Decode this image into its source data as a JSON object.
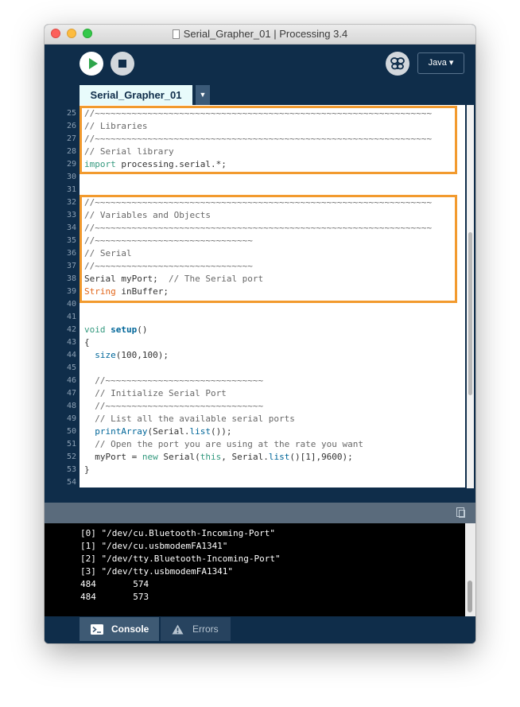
{
  "window": {
    "title": "Serial_Grapher_01 | Processing 3.4"
  },
  "toolbar": {
    "run_icon": "play-icon",
    "stop_icon": "stop-icon",
    "debug_icon": "butterfly-icon",
    "mode_label": "Java ▾"
  },
  "tabs": {
    "active": "Serial_Grapher_01",
    "menu_glyph": "▼"
  },
  "editor": {
    "lines": [
      {
        "n": "25",
        "parts": [
          {
            "t": "//~~~~~~~~~~~~~~~~~~~~~~~~~~~~~~~~~~~~~~~~~~~~~~~~~~~~~~~~~~~~~~~~",
            "c": "comment"
          }
        ]
      },
      {
        "n": "26",
        "parts": [
          {
            "t": "// Libraries",
            "c": "comment"
          }
        ]
      },
      {
        "n": "27",
        "parts": [
          {
            "t": "//~~~~~~~~~~~~~~~~~~~~~~~~~~~~~~~~~~~~~~~~~~~~~~~~~~~~~~~~~~~~~~~~",
            "c": "comment"
          }
        ]
      },
      {
        "n": "28",
        "parts": [
          {
            "t": "// Serial library",
            "c": "comment"
          }
        ]
      },
      {
        "n": "29",
        "parts": [
          {
            "t": "import",
            "c": "kw"
          },
          {
            "t": " processing.serial.*;",
            "c": "plain"
          }
        ]
      },
      {
        "n": "30",
        "parts": []
      },
      {
        "n": "31",
        "parts": []
      },
      {
        "n": "32",
        "parts": [
          {
            "t": "//~~~~~~~~~~~~~~~~~~~~~~~~~~~~~~~~~~~~~~~~~~~~~~~~~~~~~~~~~~~~~~~~",
            "c": "comment"
          }
        ]
      },
      {
        "n": "33",
        "parts": [
          {
            "t": "// Variables and Objects",
            "c": "comment"
          }
        ]
      },
      {
        "n": "34",
        "parts": [
          {
            "t": "//~~~~~~~~~~~~~~~~~~~~~~~~~~~~~~~~~~~~~~~~~~~~~~~~~~~~~~~~~~~~~~~~",
            "c": "comment"
          }
        ]
      },
      {
        "n": "35",
        "parts": [
          {
            "t": "//~~~~~~~~~~~~~~~~~~~~~~~~~~~~~~",
            "c": "comment"
          }
        ]
      },
      {
        "n": "36",
        "parts": [
          {
            "t": "// Serial",
            "c": "comment"
          }
        ]
      },
      {
        "n": "37",
        "parts": [
          {
            "t": "//~~~~~~~~~~~~~~~~~~~~~~~~~~~~~~",
            "c": "comment"
          }
        ]
      },
      {
        "n": "38",
        "parts": [
          {
            "t": "Serial myPort;  ",
            "c": "plain"
          },
          {
            "t": "// The Serial port",
            "c": "comment"
          }
        ]
      },
      {
        "n": "39",
        "parts": [
          {
            "t": "String",
            "c": "type"
          },
          {
            "t": " inBuffer;",
            "c": "plain"
          }
        ]
      },
      {
        "n": "40",
        "parts": []
      },
      {
        "n": "41",
        "parts": []
      },
      {
        "n": "42",
        "parts": [
          {
            "t": "void",
            "c": "kw"
          },
          {
            "t": " ",
            "c": "plain"
          },
          {
            "t": "setup",
            "c": "fnb"
          },
          {
            "t": "()",
            "c": "plain"
          }
        ]
      },
      {
        "n": "43",
        "parts": [
          {
            "t": "{",
            "c": "plain"
          }
        ]
      },
      {
        "n": "44",
        "parts": [
          {
            "t": "  ",
            "c": "plain"
          },
          {
            "t": "size",
            "c": "fn"
          },
          {
            "t": "(100,100);",
            "c": "plain"
          }
        ]
      },
      {
        "n": "45",
        "parts": []
      },
      {
        "n": "46",
        "parts": [
          {
            "t": "  //~~~~~~~~~~~~~~~~~~~~~~~~~~~~~~",
            "c": "comment"
          }
        ]
      },
      {
        "n": "47",
        "parts": [
          {
            "t": "  // Initialize Serial Port",
            "c": "comment"
          }
        ]
      },
      {
        "n": "48",
        "parts": [
          {
            "t": "  //~~~~~~~~~~~~~~~~~~~~~~~~~~~~~~",
            "c": "comment"
          }
        ]
      },
      {
        "n": "49",
        "parts": [
          {
            "t": "  // List all the available serial ports",
            "c": "comment"
          }
        ]
      },
      {
        "n": "50",
        "parts": [
          {
            "t": "  ",
            "c": "plain"
          },
          {
            "t": "printArray",
            "c": "fn"
          },
          {
            "t": "(Serial.",
            "c": "plain"
          },
          {
            "t": "list",
            "c": "fn"
          },
          {
            "t": "());",
            "c": "plain"
          }
        ]
      },
      {
        "n": "51",
        "parts": [
          {
            "t": "  // Open the port you are using at the rate you want",
            "c": "comment"
          }
        ]
      },
      {
        "n": "52",
        "parts": [
          {
            "t": "  myPort = ",
            "c": "plain"
          },
          {
            "t": "new",
            "c": "kw"
          },
          {
            "t": " Serial(",
            "c": "plain"
          },
          {
            "t": "this",
            "c": "kw"
          },
          {
            "t": ", Serial.",
            "c": "plain"
          },
          {
            "t": "list",
            "c": "fn"
          },
          {
            "t": "()[1],9600);",
            "c": "plain"
          }
        ]
      },
      {
        "n": "53",
        "parts": [
          {
            "t": "}",
            "c": "plain"
          }
        ]
      },
      {
        "n": "54",
        "parts": []
      }
    ]
  },
  "console": {
    "lines": [
      "[0] \"/dev/cu.Bluetooth-Incoming-Port\"",
      "[1] \"/dev/cu.usbmodemFA1341\"",
      "[2] \"/dev/tty.Bluetooth-Incoming-Port\"",
      "[3] \"/dev/tty.usbmodemFA1341\"",
      "484       574",
      "484       573"
    ]
  },
  "bottom_tabs": {
    "console_label": "Console",
    "console_icon": "terminal-icon",
    "errors_label": "Errors",
    "errors_icon": "warning-icon"
  },
  "colors": {
    "ide_background": "#0f2d4a",
    "highlight_outline": "#f29a2e",
    "tab_active": "#e8fbfb",
    "run_play": "#2ea54b"
  }
}
